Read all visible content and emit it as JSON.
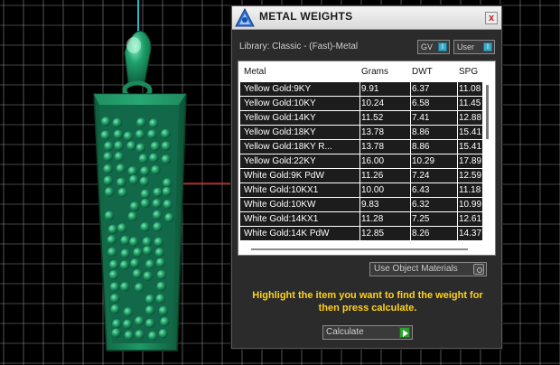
{
  "dialog": {
    "title": "METAL WEIGHTS",
    "close_label": "x",
    "library_label": "Library: Classic - (Fast)-Metal",
    "toggles": [
      {
        "label": "GV",
        "switch": "I"
      },
      {
        "label": "User",
        "switch": "I"
      }
    ],
    "table": {
      "columns": [
        "Metal",
        "Grams",
        "DWT",
        "SPG"
      ],
      "rows": [
        [
          "Yellow Gold:9KY",
          "9.91",
          "6.37",
          "11.08"
        ],
        [
          "Yellow Gold:10KY",
          "10.24",
          "6.58",
          "11.45"
        ],
        [
          "Yellow Gold:14KY",
          "11.52",
          "7.41",
          "12.88"
        ],
        [
          "Yellow Gold:18KY",
          "13.78",
          "8.86",
          "15.41"
        ],
        [
          "Yellow Gold:18KY R...",
          "13.78",
          "8.86",
          "15.41"
        ],
        [
          "Yellow Gold:22KY",
          "16.00",
          "10.29",
          "17.89"
        ],
        [
          "White Gold:9K PdW",
          "11.26",
          "7.24",
          "12.59"
        ],
        [
          "White Gold:10KX1",
          "10.00",
          "6.43",
          "11.18"
        ],
        [
          "White Gold:10KW",
          "9.83",
          "6.32",
          "10.99"
        ],
        [
          "White Gold:14KX1",
          "11.28",
          "7.25",
          "12.61"
        ],
        [
          "White Gold:14K PdW",
          "12.85",
          "8.26",
          "14.37"
        ]
      ]
    },
    "use_object_materials_label": "Use Object Materials",
    "instructions": "Highlight the item you want to find the weight for then press calculate.",
    "calculate_label": "Calculate"
  },
  "colors": {
    "accent_yellow": "#ffd21a",
    "model_green": "#1a8a5c",
    "grid_line": "#8a8a8a",
    "axis_red": "#cc2222",
    "axis_cyan": "#27b7c9"
  }
}
